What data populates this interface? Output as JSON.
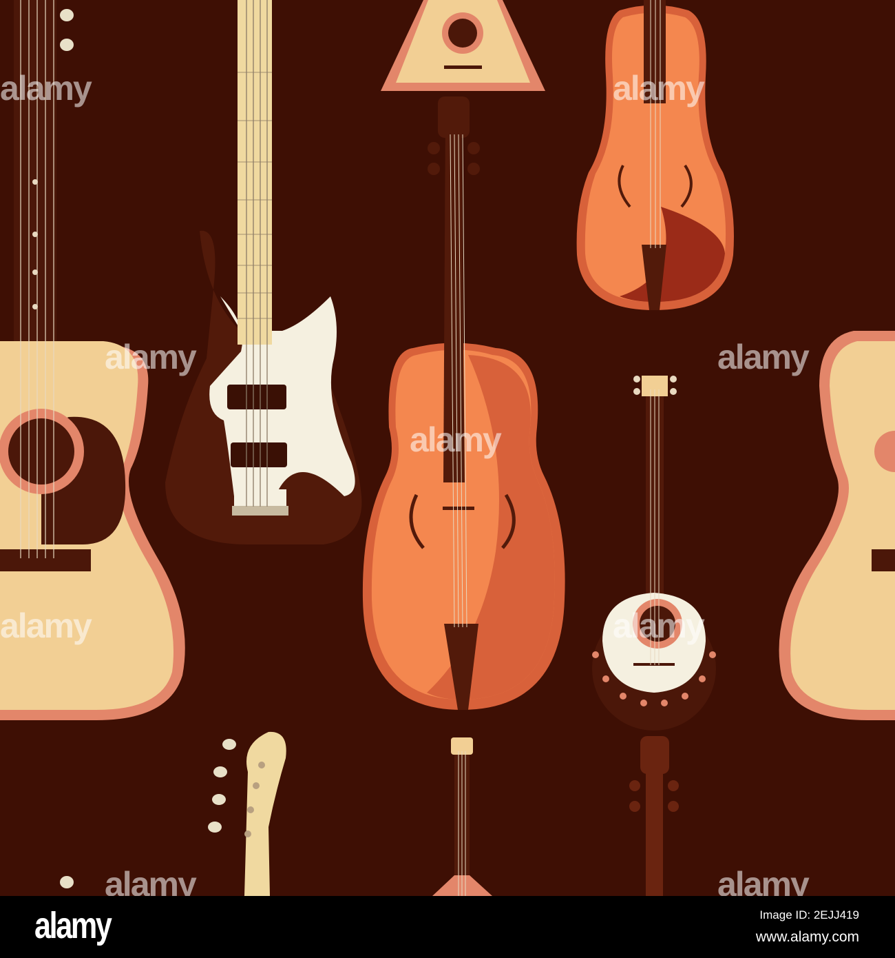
{
  "colors": {
    "background": "#3e0f04",
    "acoustic_body": "#f2cf94",
    "acoustic_edge": "#e3866a",
    "cello": "#f4874f",
    "cello_shade": "#d8613a",
    "dark": "#4b1709",
    "footer": "#000000"
  },
  "watermark": "alamy",
  "footer": {
    "logo": "alamy",
    "image_id": "Image ID: 2EJJ419",
    "website": "www.alamy.com"
  }
}
